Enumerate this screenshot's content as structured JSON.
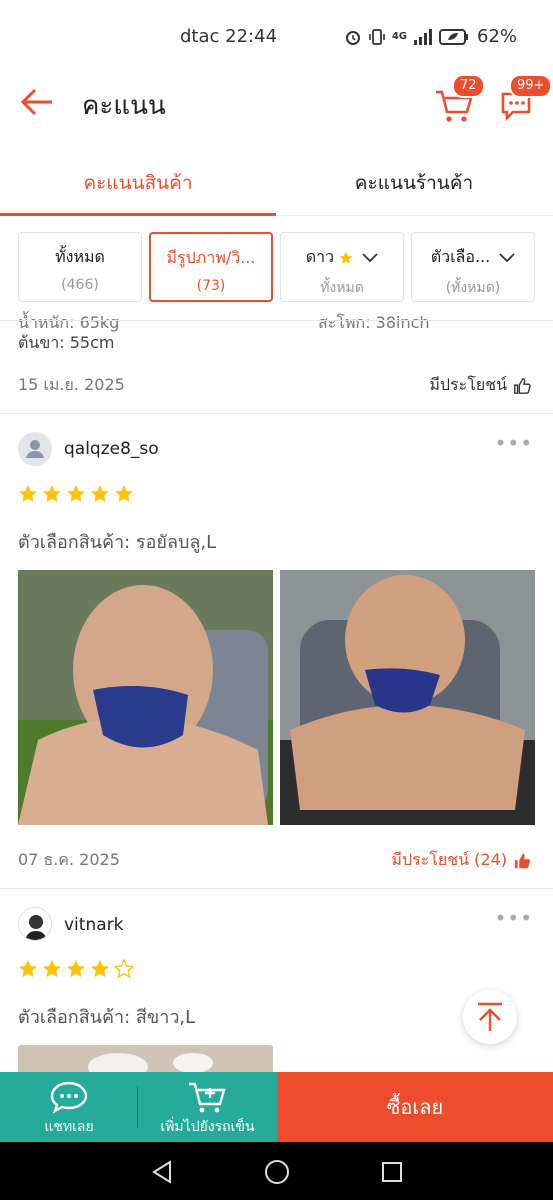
{
  "status_bar": {
    "carrier": "dtac",
    "time": "22:44",
    "battery": "62%",
    "network": "4G"
  },
  "header": {
    "title": "คะแนน",
    "cart_badge": "72",
    "chat_badge": "99+"
  },
  "tabs": [
    {
      "label": "คะแนนสินค้า",
      "active": true
    },
    {
      "label": "คะแนนร้านค้า",
      "active": false
    }
  ],
  "filters": [
    {
      "label": "ทั้งหมด",
      "sub": "(466)",
      "active": false
    },
    {
      "label": "มีรูปภาพ/วิ...",
      "sub": "(73)",
      "active": true
    },
    {
      "label": "ดาว",
      "sub": "ทั้งหมด",
      "active": false
    },
    {
      "label": "ตัวเลือ...",
      "sub": "(ทั้งหมด)",
      "active": false
    }
  ],
  "partial_review": {
    "faded_left": "น้ำหนัก: 65kg",
    "faded_right": "สะโพก: 38inch",
    "legs": "ต้นขา: 55cm",
    "date": "15 เม.ย. 2025",
    "helpful": "มีประโยชน์"
  },
  "reviews": [
    {
      "username": "qalqze8_so",
      "rating": 5,
      "variant": "ตัวเลือกสินค้า: รอยัลบลู,L",
      "photo_count": 2,
      "date": "07 ธ.ค. 2025",
      "helpful": "มีประโยชน์ (24)"
    },
    {
      "username": "vitnark",
      "rating": 4,
      "variant": "ตัวเลือกสินค้า: สีขาว,L",
      "photo_count": 1
    }
  ],
  "action_bar": {
    "chat_label": "แชทเลย",
    "cart_label": "เพิ่มไปยังรถเข็น",
    "buy_label": "ซื้อเลย"
  },
  "colors": {
    "accent": "#ee4d2d",
    "teal": "#26aa99",
    "star": "#ffc107"
  }
}
